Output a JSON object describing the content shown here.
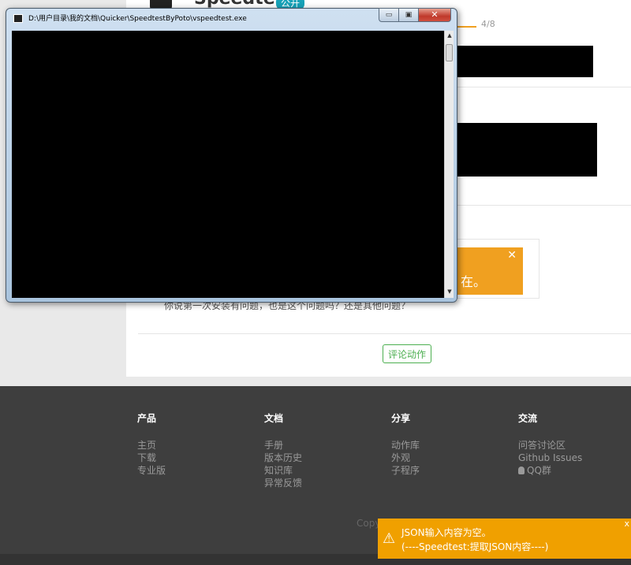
{
  "page": {
    "app_title": "Speedtest",
    "badge": "公开",
    "progress": "4/8",
    "popup_text": "在。",
    "popup_close": "✕",
    "reply_text": "你说第一次安装有问题，也是这个问题吗？还是其他问题？",
    "comment_button": "评论动作"
  },
  "footer": {
    "columns": [
      {
        "title": "产品",
        "items": [
          "主页",
          "下载",
          "专业版"
        ]
      },
      {
        "title": "文档",
        "items": [
          "手册",
          "版本历史",
          "知识库",
          "异常反馈"
        ]
      },
      {
        "title": "分享",
        "items": [
          "动作库",
          "外观",
          "子程序"
        ]
      },
      {
        "title": "交流",
        "items": [
          "问答讨论区",
          "Github Issues",
          "QQ群"
        ]
      }
    ],
    "copyright": "Copy"
  },
  "window": {
    "title": "D:\\用户目录\\我的文档\\Quicker\\SpeedtestByPoto\\vspeedtest.exe",
    "min_glyph": "▭",
    "max_glyph": "▣",
    "close_glyph": "✕",
    "scroll_up": "▲",
    "scroll_down": "▼"
  },
  "toast": {
    "line1": "JSON输入内容为空。",
    "line2": "(----Speedtest:提取JSON内容----)",
    "warn_glyph": "⚠",
    "close_glyph": "x"
  },
  "colors": {
    "accent_orange": "#f0a000",
    "comment_green": "#4caf50",
    "footer_bg": "#3e3e3e",
    "badge": "#17a2b8"
  },
  "icons": [
    "app-icon",
    "console-app-icon",
    "warning-icon",
    "qq-icon",
    "close-icon"
  ]
}
